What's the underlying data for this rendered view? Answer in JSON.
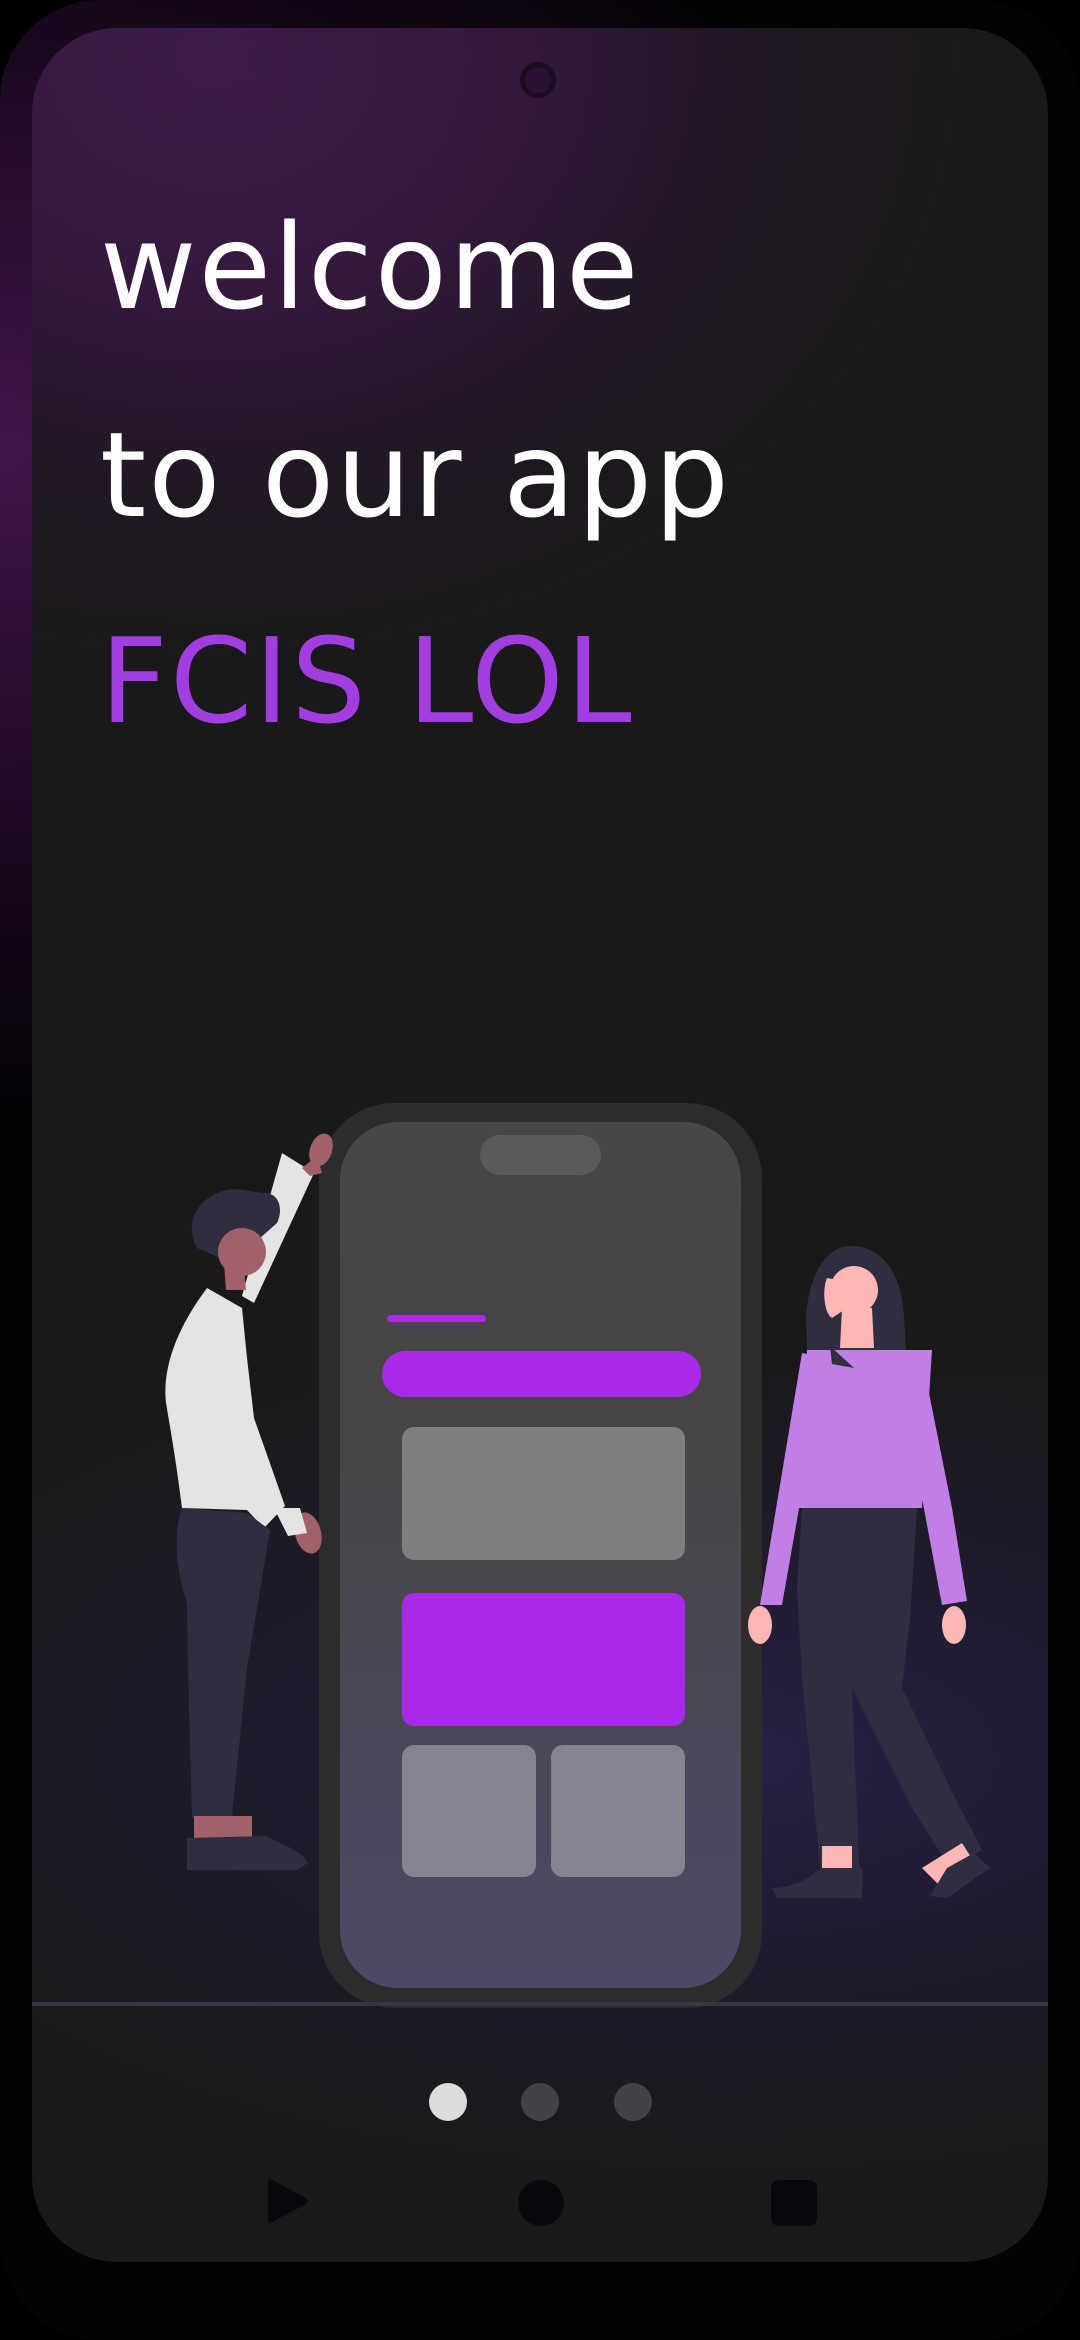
{
  "welcome": {
    "line1": "welcome",
    "line2": "to our app",
    "app_name": "FCIS LOL"
  },
  "pagination": {
    "count": 3,
    "active_index": 0
  },
  "colors": {
    "accent": "#a829e8",
    "app_name_text": "#a23ee0",
    "background": "#191919",
    "headline_text": "#ffffff"
  },
  "navigation": {
    "back_icon": "triangle-back-icon",
    "home_icon": "circle-home-icon",
    "recents_icon": "square-recents-icon"
  }
}
